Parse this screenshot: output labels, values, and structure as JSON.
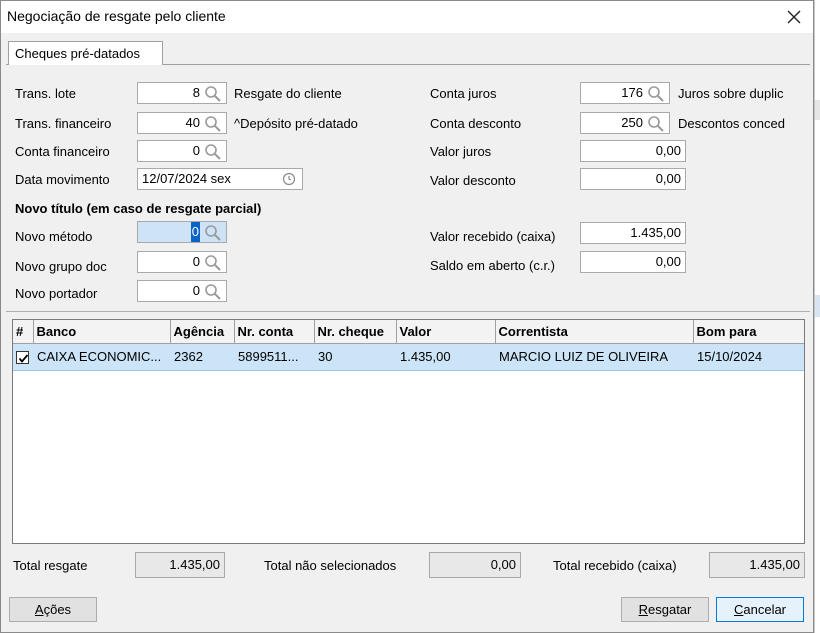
{
  "window": {
    "title": "Negociação de resgate pelo cliente"
  },
  "tab": {
    "label": "Cheques pré-datados"
  },
  "form": {
    "trans_lote": {
      "label": "Trans. lote",
      "value": "8",
      "desc": "Resgate do cliente"
    },
    "trans_financeiro": {
      "label": "Trans. financeiro",
      "value": "40",
      "desc": "^Depósito pré-datado"
    },
    "conta_financeiro": {
      "label": "Conta financeiro",
      "value": "0"
    },
    "data_movimento": {
      "label": "Data movimento",
      "value": "12/07/2024 sex"
    },
    "conta_juros": {
      "label": "Conta juros",
      "value": "176",
      "desc": "Juros sobre duplic"
    },
    "conta_desconto": {
      "label": "Conta desconto",
      "value": "250",
      "desc": "Descontos conced"
    },
    "valor_juros": {
      "label": "Valor juros",
      "value": "0,00"
    },
    "valor_desconto": {
      "label": "Valor desconto",
      "value": "0,00"
    },
    "section_title": "Novo título (em caso de resgate parcial)",
    "novo_metodo": {
      "label": "Novo método",
      "value": "0"
    },
    "novo_grupo_doc": {
      "label": "Novo grupo doc",
      "value": "0"
    },
    "novo_portador": {
      "label": "Novo portador",
      "value": "0"
    },
    "valor_recebido": {
      "label": "Valor recebido (caixa)",
      "value": "1.435,00"
    },
    "saldo_aberto": {
      "label": "Saldo em aberto (c.r.)",
      "value": "0,00"
    }
  },
  "grid": {
    "columns": [
      "#",
      "Banco",
      "Agência",
      "Nr. conta",
      "Nr. cheque",
      "Valor",
      "Correntista",
      "Bom para"
    ],
    "rows": [
      {
        "checked": true,
        "banco": "CAIXA ECONOMIC...",
        "agencia": "2362",
        "conta": "5899511...",
        "cheque": "30",
        "valor": "1.435,00",
        "correntista": "MARCIO LUIZ DE OLIVEIRA",
        "bom_para": "15/10/2024"
      }
    ]
  },
  "totals": {
    "resgate": {
      "label": "Total resgate",
      "value": "1.435,00"
    },
    "nao_selecionados": {
      "label": "Total não selecionados",
      "value": "0,00"
    },
    "recebido": {
      "label": "Total recebido (caixa)",
      "value": "1.435,00"
    }
  },
  "buttons": {
    "acoes": {
      "first": "A",
      "rest": "ções"
    },
    "resgatar": {
      "first": "R",
      "rest": "esgatar"
    },
    "cancelar": {
      "first": "C",
      "rest": "ancelar"
    }
  },
  "icons": {
    "close": "close-icon",
    "lookup": "magnifier-icon",
    "date": "clock-icon",
    "check": "check-icon"
  },
  "colors": {
    "selection": "#cce4f7",
    "focus": "#0a64c8"
  }
}
